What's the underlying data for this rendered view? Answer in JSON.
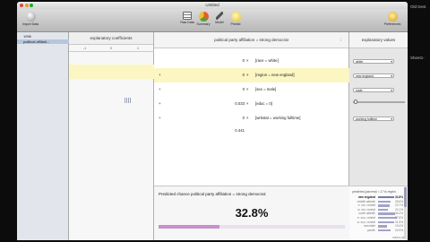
{
  "backdrop": {
    "line1": "Old Dest",
    "line2": "Sheet1-"
  },
  "window": {
    "title": "Untitled"
  },
  "toolbar": {
    "left_button": "Import Data",
    "buttons": [
      "Raw Data",
      "Summary",
      "Model",
      "Predict"
    ],
    "right_button": "Preferences"
  },
  "sidebar": {
    "items": [
      "1996",
      "political affiliati..."
    ]
  },
  "coefficients": {
    "header": "explanatory coefficients",
    "ticks": [
      "-1",
      "0",
      "1"
    ]
  },
  "main": {
    "header": "political party affiliation = strong democrat",
    "rows": [
      {
        "x": "",
        "coef": "0",
        "times": "×",
        "term": "[race = white]"
      },
      {
        "x": "+",
        "coef": "0",
        "times": "×",
        "term": "[region = new england]"
      },
      {
        "x": "+",
        "coef": "0",
        "times": "×",
        "term": "[sex = male]"
      },
      {
        "x": "+",
        "coef": "0.033",
        "times": "×",
        "term": "[educ = 0]"
      },
      {
        "x": "+",
        "coef": "0",
        "times": "×",
        "term": "[wrkstat = working fulltime]"
      },
      {
        "x": "",
        "coef": "0.441",
        "times": "",
        "term": ""
      }
    ],
    "result_label": "Predicted chance political party affiliation = strong democrat:",
    "result_value": "32.8%",
    "result_fraction": 0.328
  },
  "explanatory": {
    "header": "explanatory values",
    "dropdowns": [
      "white",
      "new england",
      "male",
      "",
      "working fulltime"
    ],
    "slider_fraction": 0.02
  },
  "prediction": {
    "title": "predicted (parcent) = 17 to region",
    "rows": [
      {
        "name": "new england",
        "value": "32.8%",
        "selected": true,
        "fraction": 0.33
      },
      {
        "name": "middle atlantic",
        "value": "25.6%",
        "fraction": 0.26
      },
      {
        "name": "e. nor. central",
        "value": "23.7%",
        "fraction": 0.24
      },
      {
        "name": "w. nor. central",
        "value": "20.1%",
        "fraction": 0.2
      },
      {
        "name": "south atlantic",
        "value": "34.2%",
        "fraction": 0.34
      },
      {
        "name": "e. sou. central",
        "value": "37.8%",
        "fraction": 0.38
      },
      {
        "name": "w. sou. central",
        "value": "31.5%",
        "fraction": 0.32
      },
      {
        "name": "mountain",
        "value": "19.4%",
        "fraction": 0.19
      },
      {
        "name": "pacific",
        "value": "24.9%",
        "fraction": 0.25
      }
    ],
    "footer": "RSS 0.441"
  },
  "colors": {
    "highlight": "#fbf6c2",
    "result_bar": "#c890cc",
    "selection": "#b6c6de"
  }
}
